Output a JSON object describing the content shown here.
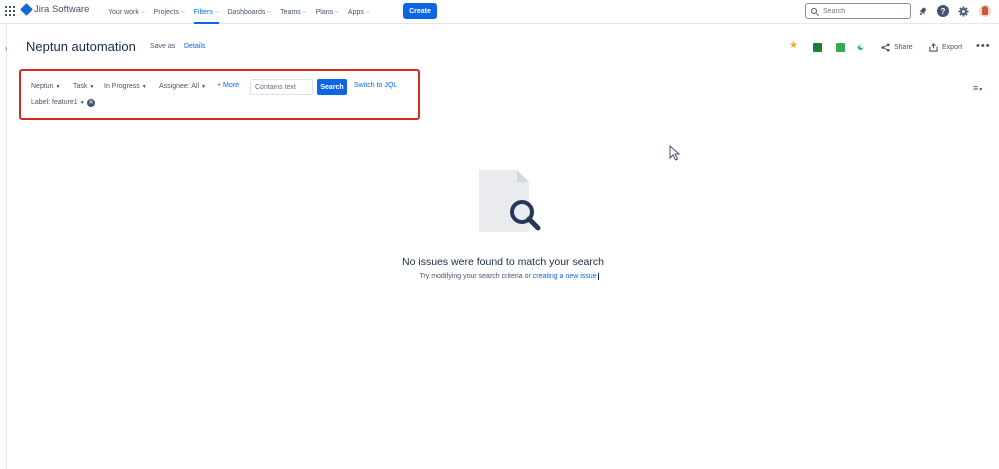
{
  "topnav": {
    "product": "Jira Software",
    "items": [
      {
        "label": "Your work",
        "active": false
      },
      {
        "label": "Projects",
        "active": false
      },
      {
        "label": "Filters",
        "active": true
      },
      {
        "label": "Dashboards",
        "active": false
      },
      {
        "label": "Teams",
        "active": false
      },
      {
        "label": "Plans",
        "active": false
      },
      {
        "label": "Apps",
        "active": false
      }
    ],
    "create_label": "Create",
    "search_placeholder": "Search",
    "help_glyph": "?"
  },
  "header": {
    "title": "Neptun automation",
    "save_as": "Save as",
    "details": "Details",
    "share": "Share",
    "export": "Export",
    "more_glyph": "•••"
  },
  "filters": {
    "project": "Neptun",
    "type": "Task",
    "status": "In Progress",
    "assignee": "Assignee: All",
    "more": "+ More",
    "text_placeholder": "Contains text",
    "search_button": "Search",
    "switch_jql": "Switch to JQL",
    "label": "Label: feature1"
  },
  "empty_state": {
    "title": "No issues were found to match your search",
    "subtitle_prefix": "Try modifying your search criteria or ",
    "subtitle_link": "creating a new issue"
  },
  "colors": {
    "accent": "#0c66e4",
    "highlight_frame": "#d62c1f",
    "text": "#172b4d"
  },
  "icons": {
    "app_switcher": "grid-icon",
    "notifications": "bell-icon",
    "help": "help-icon",
    "settings": "gear-icon",
    "star": "star-icon",
    "excel": "excel-icon",
    "sheets": "sheets-icon",
    "share": "share-icon",
    "export": "export-icon"
  }
}
